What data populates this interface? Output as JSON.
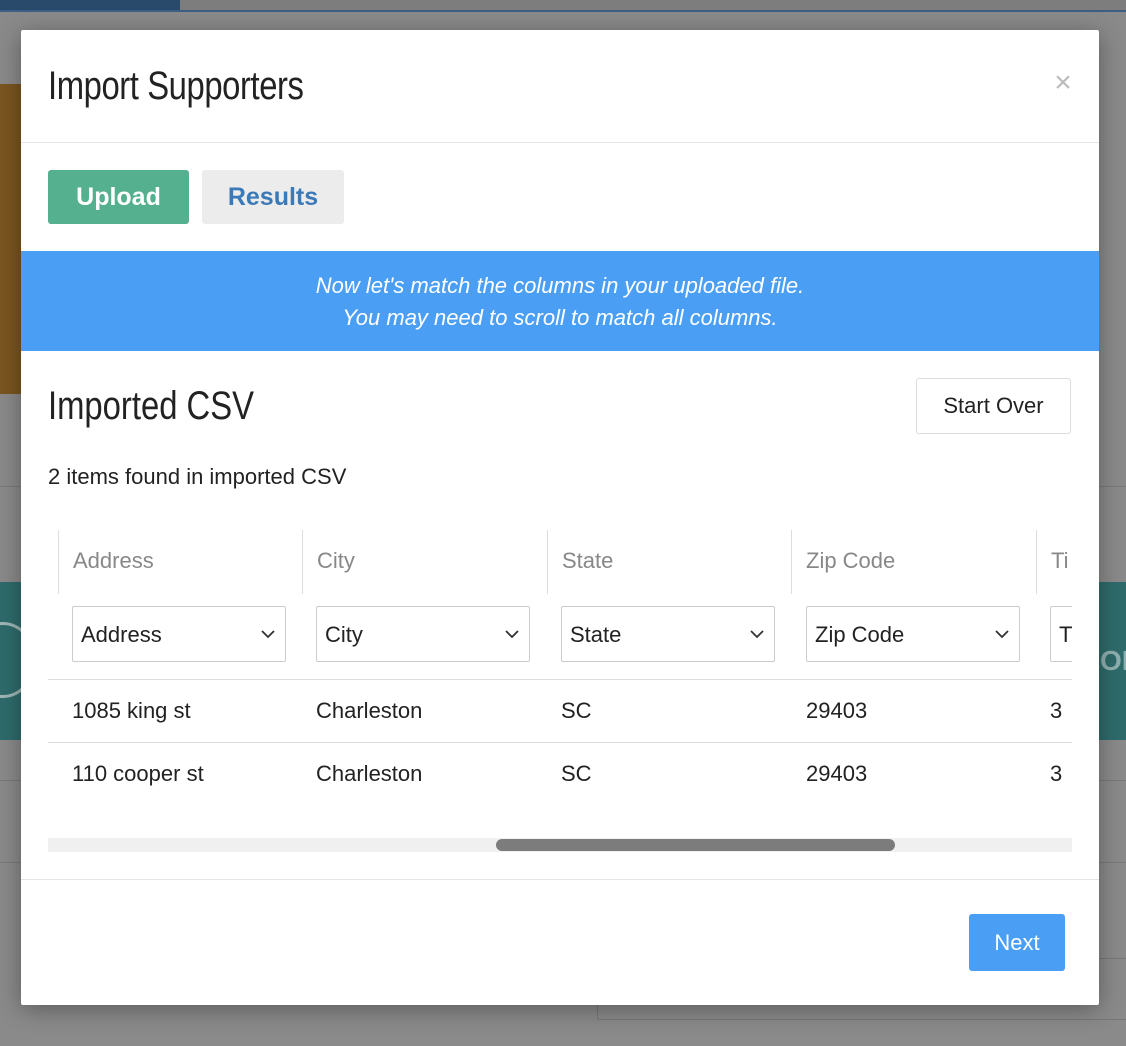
{
  "modal": {
    "title": "Import Supporters",
    "close_label": "×",
    "tabs": [
      {
        "label": "Upload"
      },
      {
        "label": "Results"
      }
    ],
    "banner": {
      "line1": "Now let's match the columns in your uploaded file.",
      "line2": "You may need to scroll to match all columns."
    },
    "section_title": "Imported CSV",
    "start_over_label": "Start Over",
    "items_found": "2 items found in imported CSV",
    "table": {
      "headers": [
        "Address",
        "City",
        "State",
        "Zip Code",
        "Ti"
      ],
      "selects": [
        "Address",
        "City",
        "State",
        "Zip Code",
        "T"
      ],
      "rows": [
        [
          "1085 king st",
          "Charleston",
          "SC",
          "29403",
          "3"
        ],
        [
          "110 cooper st",
          "Charleston",
          "SC",
          "29403",
          "3"
        ]
      ]
    },
    "next_label": "Next"
  },
  "background": {
    "teal_text": "OR"
  }
}
